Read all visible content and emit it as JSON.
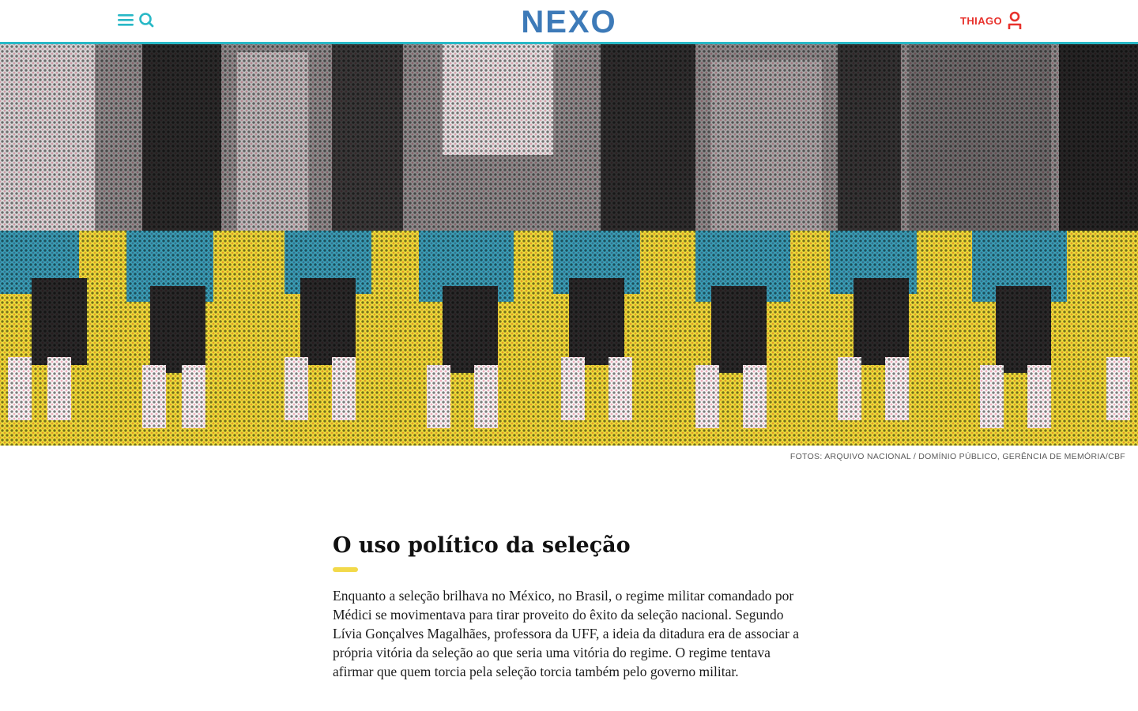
{
  "header": {
    "logo_text": "NEXO",
    "user_name": "THIAGO",
    "icons": {
      "menu": "hamburger-icon",
      "search": "search-icon",
      "user": "user-icon"
    },
    "colors": {
      "accent": "#28b8c6",
      "user": "#e8322d",
      "logo_blue": "#3d7ab8",
      "logo_purple": "#7a6ab0",
      "logo_teal": "#28b8c6"
    }
  },
  "hero": {
    "caption": "FOTOS: ARQUIVO NACIONAL / DOMÍNIO PÚBLICO, GERÊNCIA DE MEMÓRIA/CBF"
  },
  "article": {
    "section_title": "O uso político da seleção",
    "accent_color": "#f2d94a",
    "paragraph": "Enquanto a seleção brilhava no México, no Brasil, o regime militar comandado por Médici se movimentava para tirar proveito do êxito da seleção nacional. Segundo Lívia Gonçalves Magalhães, professora da UFF, a ideia da ditadura era de associar a própria vitória da seleção ao que seria uma vitória do regime. O regime tentava afirmar que quem torcia pela seleção torcia também pelo governo militar."
  }
}
